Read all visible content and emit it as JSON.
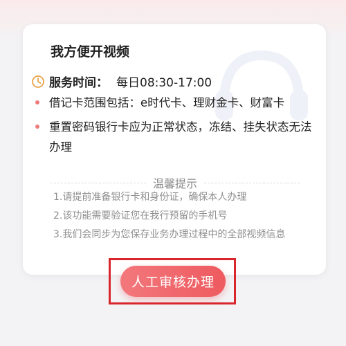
{
  "card": {
    "title": "我方便开视频",
    "service_label": "服务时间：",
    "service_value": "每日08:30-17:00",
    "bullets": [
      "借记卡范围包括：e时代卡、理财金卡、财富卡",
      "重置密码银行卡应为正常状态，冻结、挂失状态无法办理"
    ]
  },
  "tips": {
    "title": "温馨提示",
    "items": [
      "1.请提前准备银行卡和身份证，确保本人办理",
      "2.该功能需要验证您在我行预留的手机号",
      "3.我们会同步为您保存业务办理过程中的全部视频信息"
    ]
  },
  "actions": {
    "submit_label": "人工审核办理"
  },
  "colors": {
    "accent": "#ee5a5f",
    "highlight_border": "#d9262c",
    "bullet": "#ee7a7a"
  },
  "icons": {
    "service_time": "clock-icon",
    "background_decoration": "headset-watermark-icon"
  }
}
